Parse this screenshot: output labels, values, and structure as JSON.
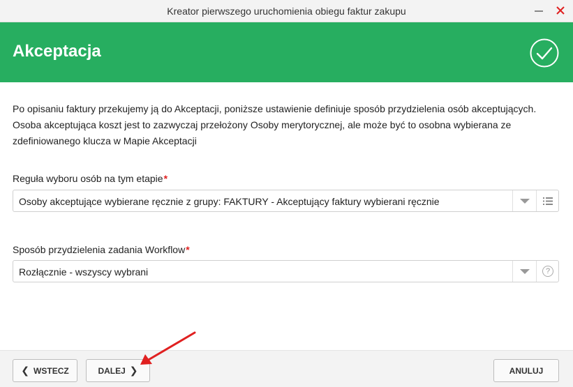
{
  "window": {
    "title": "Kreator pierwszego uruchomienia obiegu faktur zakupu",
    "minimize_icon": "minimize-icon",
    "close_icon": "close-icon"
  },
  "header": {
    "title": "Akceptacja",
    "icon": "check-circle-icon",
    "background": "#27ae60"
  },
  "description": "Po opisaniu faktury przekujemy ją do Akceptacji, poniższe ustawienie definiuje sposób przydzielenia osób akceptujących. Osoba akceptująca koszt jest to zazwyczaj przełożony Osoby merytorycznej, ale może być to osobna wybierana ze zdefiniowanego klucza w Mapie Akceptacji",
  "fields": [
    {
      "label": "Reguła wyboru osób na tym etapie",
      "required_mark": "*",
      "value": "Osoby akceptujące wybierane ręcznie z grupy: FAKTURY - Akceptujący faktury wybierani ręcznie",
      "extra_icon": "list-icon"
    },
    {
      "label": "Sposób przydzielenia zadania Workflow",
      "required_mark": "*",
      "value": "Rozłącznie - wszyscy wybrani",
      "extra_icon": "help-icon",
      "extra_text": "?"
    }
  ],
  "footer": {
    "back_label": "WSTECZ",
    "next_label": "DALEJ",
    "cancel_label": "ANULUJ"
  },
  "colors": {
    "accent": "#27ae60",
    "required": "#e02020",
    "annotation_arrow": "#e02020"
  }
}
